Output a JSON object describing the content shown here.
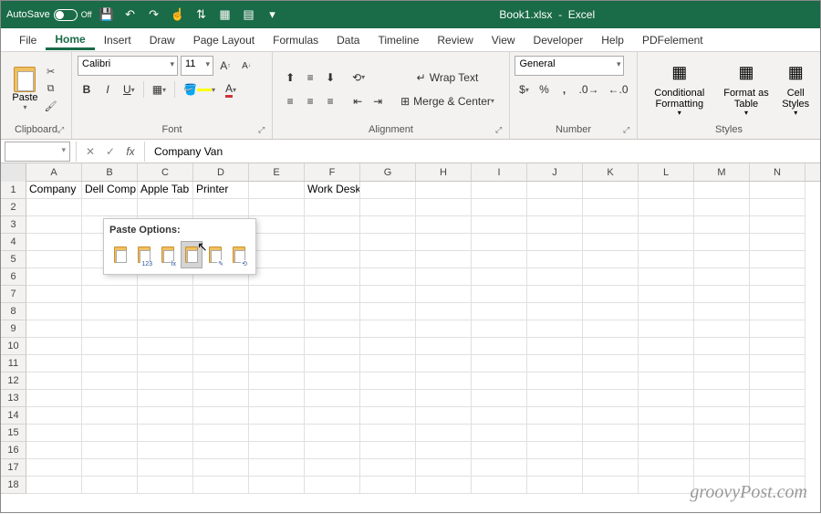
{
  "titlebar": {
    "autosave_label": "AutoSave",
    "autosave_state": "Off",
    "document": "Book1.xlsx",
    "app": "Excel"
  },
  "qat": [
    "save-icon",
    "undo-icon",
    "redo-icon",
    "touch-mode-icon",
    "sort-icon",
    "pivot-icon",
    "freeze-icon",
    "more-icon"
  ],
  "tabs": [
    "File",
    "Home",
    "Insert",
    "Draw",
    "Page Layout",
    "Formulas",
    "Data",
    "Timeline",
    "Review",
    "View",
    "Developer",
    "Help",
    "PDFelement"
  ],
  "active_tab": "Home",
  "ribbon": {
    "clipboard": {
      "label": "Clipboard",
      "paste": "Paste"
    },
    "font": {
      "label": "Font",
      "name": "Calibri",
      "size": "11",
      "increase": "A",
      "decrease": "A",
      "bold": "B",
      "italic": "I",
      "underline": "U"
    },
    "alignment": {
      "label": "Alignment",
      "wrap": "Wrap Text",
      "merge": "Merge & Center"
    },
    "number": {
      "label": "Number",
      "format": "General"
    },
    "styles": {
      "label": "Styles",
      "cond": "Conditional Formatting",
      "table": "Format as Table",
      "cell": "Cell Styles"
    }
  },
  "formula_bar": {
    "name_box": "",
    "value": "Company Van",
    "fx": "fx"
  },
  "columns": [
    "A",
    "B",
    "C",
    "D",
    "E",
    "F",
    "G",
    "H",
    "I",
    "J",
    "K",
    "L",
    "M",
    "N"
  ],
  "row_count": 18,
  "cells": {
    "r1": [
      "Company",
      "Dell Comp",
      "Apple Tab",
      "Printer",
      "",
      "Work Desk",
      "",
      "",
      "",
      "",
      "",
      "",
      "",
      ""
    ]
  },
  "paste_popup": {
    "title": "Paste Options:",
    "options": [
      {
        "name": "paste",
        "sub": ""
      },
      {
        "name": "values",
        "sub": "123"
      },
      {
        "name": "formulas",
        "sub": "fx"
      },
      {
        "name": "transpose",
        "sub": ""
      },
      {
        "name": "formatting",
        "sub": "✎"
      },
      {
        "name": "link",
        "sub": "⟲"
      }
    ],
    "selected": 3
  },
  "watermark": "groovyPost.com"
}
